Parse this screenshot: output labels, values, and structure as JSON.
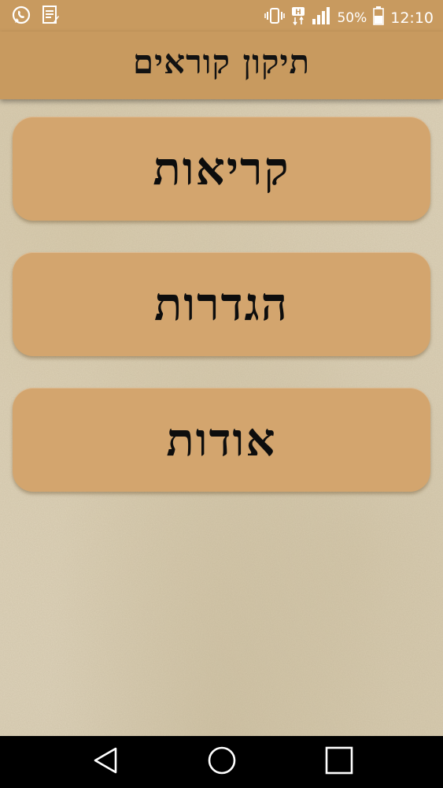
{
  "status_bar": {
    "battery_percent": "50%",
    "clock": "12:10",
    "icons": [
      "whatsapp-icon",
      "notes-icon",
      "vibrate-icon",
      "hd-signal-icon",
      "cell-signal-icon",
      "battery-icon"
    ]
  },
  "header": {
    "title": "תיקון קוראים"
  },
  "menu": {
    "items": [
      {
        "label": "קריאות"
      },
      {
        "label": "הגדרות"
      },
      {
        "label": "אודות"
      }
    ]
  },
  "nav_bar": {
    "icons": [
      "back-icon",
      "home-icon",
      "recents-icon"
    ]
  },
  "colors": {
    "header": "#c89a5f",
    "button": "#d3a56e",
    "background": "#e0d5bd",
    "text": "#121212",
    "nav_bar": "#000000"
  }
}
